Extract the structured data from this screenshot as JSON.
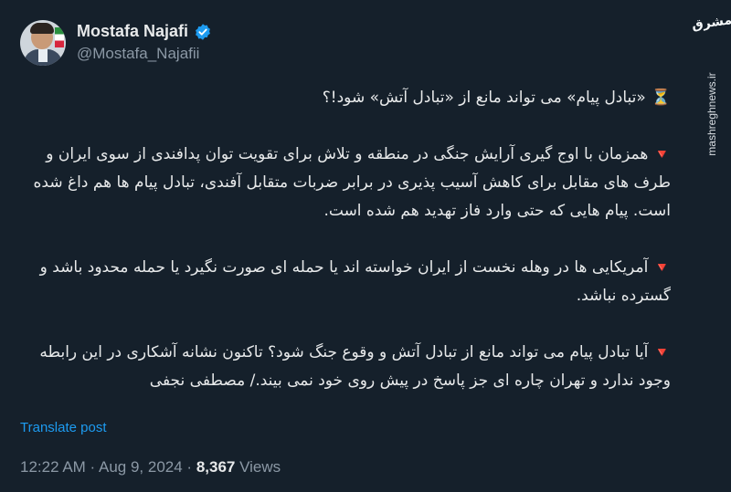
{
  "author": {
    "display_name": "Mostafa Najafi",
    "handle": "@Mostafa_Najafii",
    "verified": true
  },
  "tweet": {
    "title_line": "«تبادل پیام» می تواند مانع از «تبادل آتش» شود!؟",
    "paragraphs": [
      "همزمان با اوج گیری آرایش جنگی در منطقه و تلاش برای تقویت توان پدافندی از سوی ایران و طرف های مقابل برای کاهش آسیب پذیری در برابر ضربات متقابل آفندی، تبادل پیام ها هم داغ شده است. پیام هایی که حتی وارد فاز تهدید هم شده است.",
      "آمریکایی ها در وهله نخست از ایران خواسته اند یا حمله ای صورت نگیرد یا حمله محدود باشد و گسترده نباشد.",
      "آیا تبادل پیام می تواند مانع از تبادل آتش و وقوع جنگ شود؟ تاکنون نشانه آشکاری در این رابطه وجود ندارد و تهران چاره ای جز پاسخ در پیش روی خود نمی بیند./ مصطفی نجفی"
    ],
    "bullet_symbol": "🔻",
    "title_symbol": "⏳"
  },
  "translate_label": "Translate post",
  "meta": {
    "time": "12:22 AM",
    "separator": " · ",
    "date": "Aug 9, 2024",
    "views_count": "8,367",
    "views_label": " Views"
  },
  "watermark": {
    "logo_text": "مشرق",
    "site": "mashreghnews.ir"
  },
  "colors": {
    "background": "#15202b",
    "text": "#e7e9ea",
    "muted": "#8b98a5",
    "link": "#1d9bf0",
    "bullet": "#f4212e"
  }
}
